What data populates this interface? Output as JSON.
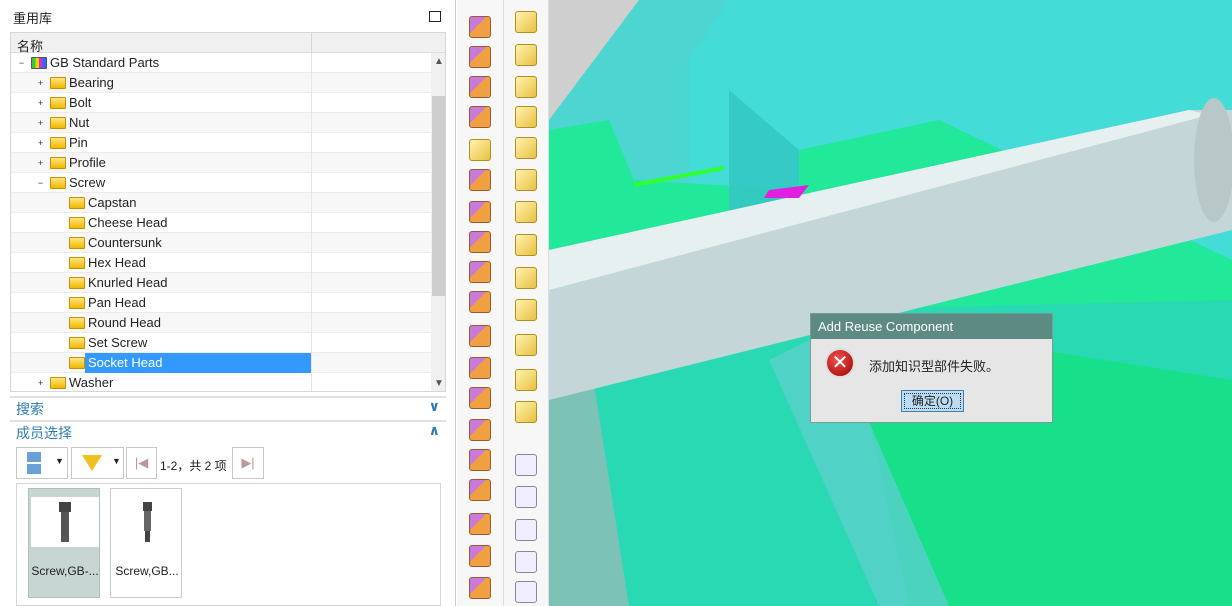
{
  "panel": {
    "title": "重用库",
    "maximize_icon": "maximize-icon"
  },
  "tree": {
    "header": "名称",
    "items": [
      {
        "label": "GB Standard Parts",
        "level": 0,
        "expanded": true,
        "icon": "library-books-icon"
      },
      {
        "label": "Bearing",
        "level": 1,
        "expanded": false
      },
      {
        "label": "Bolt",
        "level": 1,
        "expanded": false
      },
      {
        "label": "Nut",
        "level": 1,
        "expanded": false
      },
      {
        "label": "Pin",
        "level": 1,
        "expanded": false
      },
      {
        "label": "Profile",
        "level": 1,
        "expanded": false
      },
      {
        "label": "Screw",
        "level": 1,
        "expanded": true
      },
      {
        "label": "Capstan",
        "level": 2
      },
      {
        "label": "Cheese Head",
        "level": 2
      },
      {
        "label": "Countersunk",
        "level": 2
      },
      {
        "label": "Hex Head",
        "level": 2
      },
      {
        "label": "Knurled Head",
        "level": 2
      },
      {
        "label": "Pan Head",
        "level": 2
      },
      {
        "label": "Round Head",
        "level": 2
      },
      {
        "label": "Set Screw",
        "level": 2
      },
      {
        "label": "Socket Head",
        "level": 2,
        "selected": true
      },
      {
        "label": "Washer",
        "level": 1,
        "expanded": false
      }
    ]
  },
  "search": {
    "label": "搜索"
  },
  "members": {
    "label": "成员选择",
    "paging": "1-2，共 2 项",
    "items": [
      {
        "label": "Screw,GB-...",
        "selected": true
      },
      {
        "label": "Screw,GB..."
      }
    ]
  },
  "dialog": {
    "title": "Add Reuse Component",
    "message": "添加知识型部件失败。",
    "ok": "确定(O)"
  },
  "colors": {
    "selection": "#3399ff",
    "dialog_title": "#5e8a84",
    "section_header": "#2f7cb5",
    "cyan": "#40d8d0",
    "green": "#20e890"
  }
}
